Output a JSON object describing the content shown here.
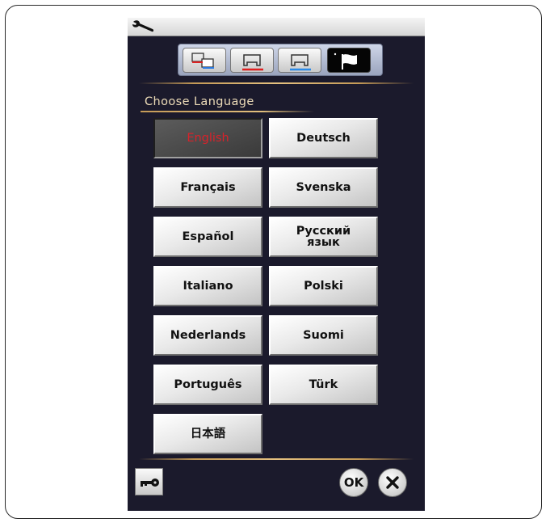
{
  "header": {
    "tool_icon": "wrench-icon"
  },
  "tabs": [
    {
      "icon": "machine-settings-icon"
    },
    {
      "icon": "sewing-settings-icon"
    },
    {
      "icon": "embroidery-settings-icon"
    },
    {
      "icon": "flag-language-icon",
      "active": true
    }
  ],
  "section": {
    "title": "Choose Language"
  },
  "languages": [
    {
      "label": "English",
      "selected": true
    },
    {
      "label": "Deutsch"
    },
    {
      "label": "Français"
    },
    {
      "label": "Svenska"
    },
    {
      "label": "Español"
    },
    {
      "label": "Русский\nязык"
    },
    {
      "label": "Italiano"
    },
    {
      "label": "Polski"
    },
    {
      "label": "Nederlands"
    },
    {
      "label": "Suomi"
    },
    {
      "label": "Português"
    },
    {
      "label": "Türk"
    },
    {
      "label": "日本語"
    }
  ],
  "footer": {
    "lock_icon": "key-icon",
    "ok_label": "OK",
    "cancel_icon": "close-icon"
  },
  "colors": {
    "screen_bg": "#1b1a2c",
    "heading_text": "#eddcb8",
    "separator": "#c49a57",
    "selected_text": "#d8222a"
  }
}
